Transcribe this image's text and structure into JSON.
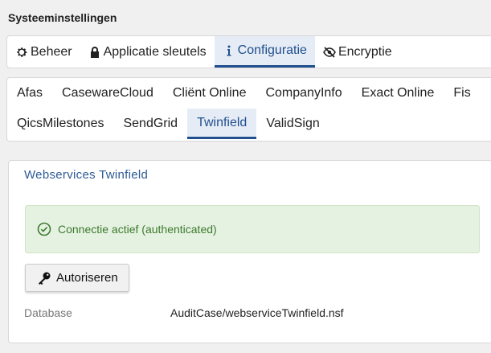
{
  "page": {
    "title": "Systeeminstellingen"
  },
  "main_tabs": [
    {
      "label": "Beheer",
      "icon": "gear-icon",
      "active": false
    },
    {
      "label": "Applicatie sleutels",
      "icon": "lock-icon",
      "active": false
    },
    {
      "label": "Configuratie",
      "icon": "info-icon",
      "active": true
    },
    {
      "label": "Encryptie",
      "icon": "eye-slash-icon",
      "active": false
    }
  ],
  "sub_tabs": {
    "row1": [
      "Afas",
      "CasewareCloud",
      "Cliënt Online",
      "CompanyInfo",
      "Exact Online",
      "Fis"
    ],
    "row2": [
      "QicsMilestones",
      "SendGrid",
      "Twinfield",
      "ValidSign"
    ],
    "active": "Twinfield"
  },
  "panel": {
    "title": "Webservices Twinfield",
    "alert": {
      "icon": "check-circle-icon",
      "text": "Connectie actief (authenticated)"
    },
    "button": {
      "icon": "key-icon",
      "label": "Autoriseren"
    },
    "field": {
      "label": "Database",
      "value": "AuditCase/webserviceTwinfield.nsf"
    }
  },
  "colors": {
    "accent": "#1f4f8f",
    "active_tab_bg": "#e6ecf5",
    "success_bg": "#e6f2e1",
    "success_text": "#3c7a2f"
  }
}
